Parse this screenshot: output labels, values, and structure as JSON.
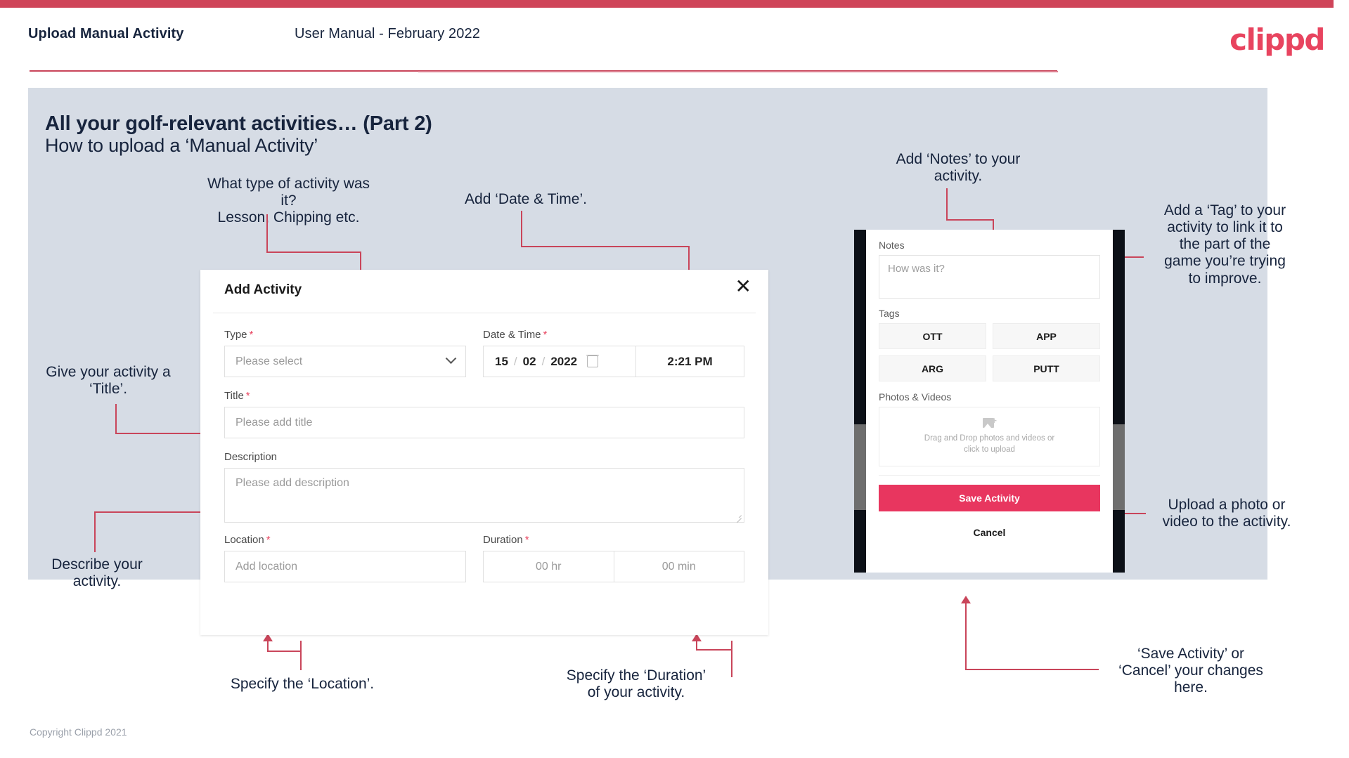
{
  "header": {
    "title": "Upload Manual Activity",
    "subtitle": "User Manual - February 2022",
    "logo": "clippd"
  },
  "slide": {
    "title_main": "All your golf-relevant activities… (Part 2)",
    "title_sub": "How to upload a ‘Manual Activity’"
  },
  "annotations": {
    "type": "What type of activity was it?\nLesson, Chipping etc.",
    "datetime": "Add ‘Date & Time’.",
    "title": "Give your activity a\n‘Title’.",
    "description": "Describe your\nactivity.",
    "location": "Specify the ‘Location’.",
    "duration": "Specify the ‘Duration’\nof your activity.",
    "notes": "Add ‘Notes’ to your\nactivity.",
    "tags": "Add a ‘Tag’ to your\nactivity to link it to\nthe part of the\ngame you’re trying\nto improve.",
    "photos": "Upload a photo or\nvideo to the activity.",
    "save": "‘Save Activity’ or\n‘Cancel’ your changes\nhere."
  },
  "dialog": {
    "title": "Add Activity",
    "close_icon": "✕",
    "fields": {
      "type": {
        "label": "Type",
        "required": "*",
        "placeholder": "Please select"
      },
      "datetime": {
        "label": "Date & Time",
        "required": "*",
        "day": "15",
        "month": "02",
        "year": "2022",
        "sep": "/",
        "time": "2:21 PM"
      },
      "title": {
        "label": "Title",
        "required": "*",
        "placeholder": "Please add title"
      },
      "description": {
        "label": "Description",
        "placeholder": "Please add description"
      },
      "location": {
        "label": "Location",
        "required": "*",
        "placeholder": "Add location"
      },
      "duration": {
        "label": "Duration",
        "required": "*",
        "hours_placeholder": "00 hr",
        "minutes_placeholder": "00 min"
      }
    }
  },
  "mobile": {
    "notes_label": "Notes",
    "notes_placeholder": "How was it?",
    "tags_label": "Tags",
    "tags": [
      "OTT",
      "APP",
      "ARG",
      "PUTT"
    ],
    "photos_label": "Photos & Videos",
    "drop_text": "Drag and Drop photos and videos or\nclick to upload",
    "save_label": "Save Activity",
    "cancel_label": "Cancel"
  },
  "footer": {
    "copyright": "Copyright Clippd 2021"
  },
  "colors": {
    "brand_pink": "#e8445f",
    "accent_crimson": "#c9455a",
    "slide_bg": "#d6dce5",
    "text_dark": "#17243d"
  }
}
